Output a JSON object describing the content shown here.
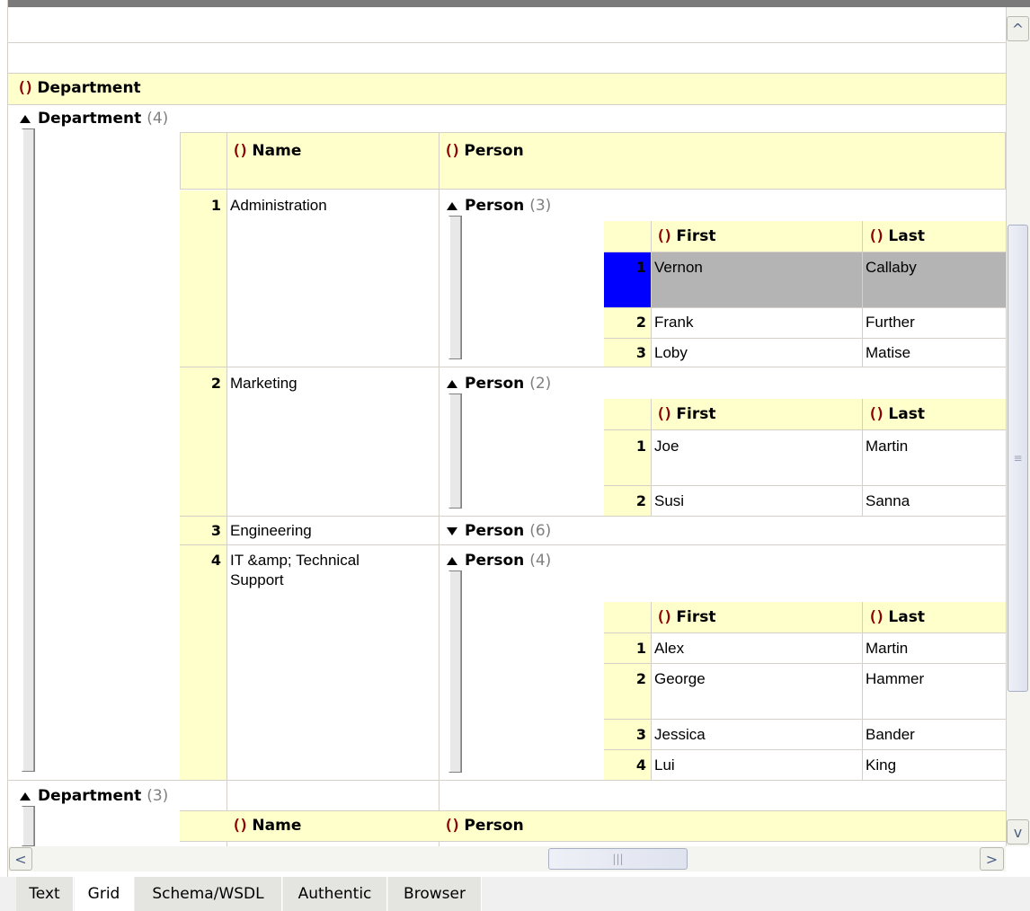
{
  "root_element": "Department",
  "group_label": "Department",
  "groups": [
    {
      "count": "(4)"
    },
    {
      "count": "(3)"
    }
  ],
  "columns": {
    "name": "Name",
    "person": "Person",
    "first": "First",
    "last": "Last"
  },
  "person_label": "Person",
  "departments": [
    {
      "index": "1",
      "name": "Administration",
      "person_count": "(3)",
      "people": [
        {
          "index": "1",
          "first": "Vernon",
          "last": "Callaby"
        },
        {
          "index": "2",
          "first": "Frank",
          "last": "Further"
        },
        {
          "index": "3",
          "first": "Loby",
          "last": "Matise"
        }
      ]
    },
    {
      "index": "2",
      "name": "Marketing",
      "person_count": "(2)",
      "people": [
        {
          "index": "1",
          "first": "Joe",
          "last": "Martin"
        },
        {
          "index": "2",
          "first": "Susi",
          "last": "Sanna"
        }
      ]
    },
    {
      "index": "3",
      "name": "Engineering",
      "person_count": "(6)",
      "people": []
    },
    {
      "index": "4",
      "name_line1": "IT &amp; Technical",
      "name_line2": "Support",
      "person_count": "(4)",
      "people": [
        {
          "index": "1",
          "first": "Alex",
          "last": "Martin"
        },
        {
          "index": "2",
          "first": "George",
          "last": "Hammer"
        },
        {
          "index": "3",
          "first": "Jessica",
          "last": "Bander"
        },
        {
          "index": "4",
          "first": "Lui",
          "last": "King"
        }
      ]
    }
  ],
  "tabs": [
    "Text",
    "Grid",
    "Schema/WSDL",
    "Authentic",
    "Browser"
  ],
  "active_tab": "Grid",
  "scrollbar": {
    "up": "^",
    "down": "v",
    "left": "<",
    "right": ">",
    "vgrip": "≡",
    "hgrip": "|||"
  },
  "brace_icon": "()",
  "colors": {
    "header_bg": "#ffffcc",
    "selected_row": "#b4b4b4",
    "selected_marker": "#0000ff",
    "brace": "#8b0000"
  }
}
